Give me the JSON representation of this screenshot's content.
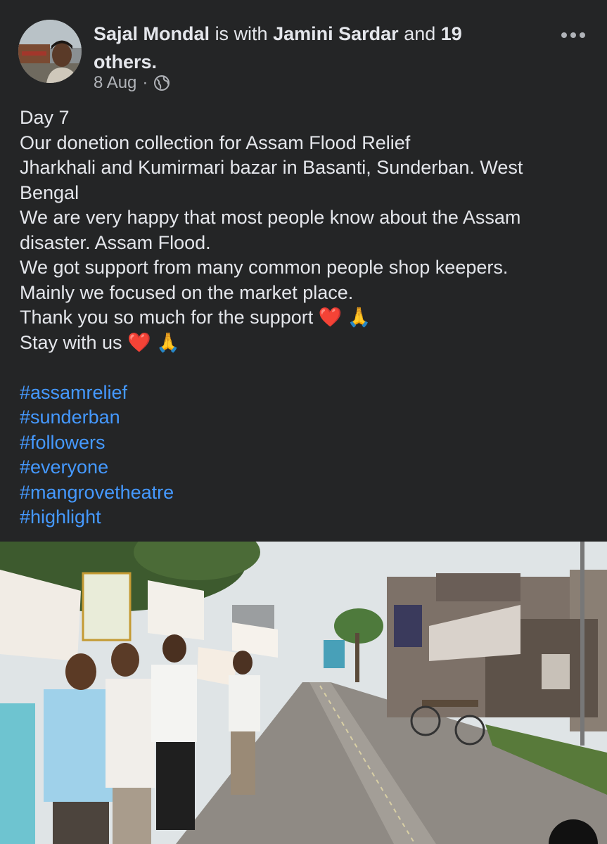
{
  "post": {
    "author": "Sajal Mondal",
    "with_text": "is with",
    "tagged": "Jamini Sardar",
    "and_text": "and",
    "others_count": "19",
    "others_text": "others.",
    "date": "8 Aug",
    "separator": "·",
    "privacy_icon": "globe-icon",
    "more_icon": "more-options-icon",
    "lines": [
      "Day 7",
      "Our donetion collection for Assam Flood Relief",
      "Jharkhali and Kumirmari bazar in Basanti, Sunderban. West",
      "Bengal",
      "We are very happy that most people know about the Assam",
      "disaster. Assam Flood.",
      "We got support from many common people shop keepers.",
      "Mainly we focused on the market place.",
      "Thank you so much for the support",
      "Stay with us"
    ],
    "emoji_heart": "❤️",
    "emoji_pray": "🙏",
    "hashtags": [
      "#assamrelief",
      "#sunderban",
      "#followers",
      "#everyone",
      "#mangrovetheatre",
      "#highlight"
    ]
  },
  "colors": {
    "background": "#242526",
    "text": "#e4e6eb",
    "secondary": "#b0b3b8",
    "hashtag": "#4599ff"
  }
}
